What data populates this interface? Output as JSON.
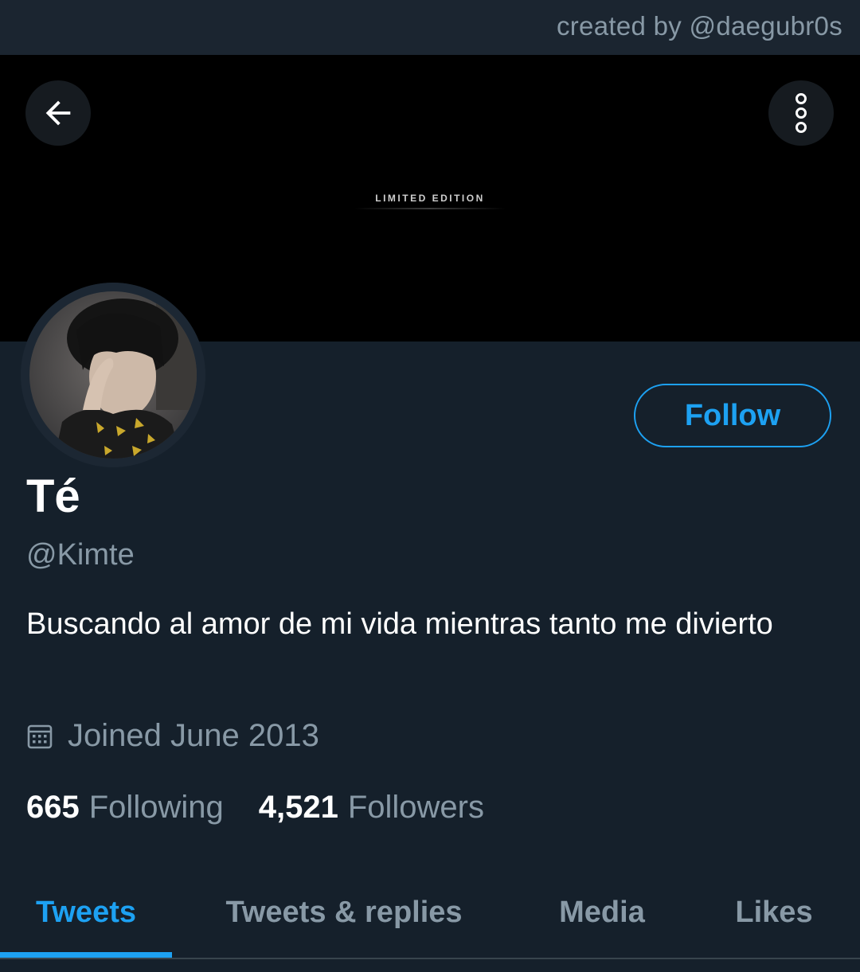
{
  "watermark": "created by @daegubr0s",
  "banner": {
    "text": "LIMITED EDITION"
  },
  "header": {
    "back_icon": "arrow-left-icon",
    "more_icon": "more-vertical-icon"
  },
  "profile": {
    "display_name": "Té",
    "handle": "@Kimte",
    "bio": "Buscando al amor de mi vida mientras tanto me divierto",
    "joined": "Joined June 2013",
    "joined_icon": "calendar-icon",
    "follow_label": "Follow",
    "following_count": "665",
    "following_label": "Following",
    "followers_count": "4,521",
    "followers_label": "Followers"
  },
  "tabs": [
    {
      "label": "Tweets",
      "active": true
    },
    {
      "label": "Tweets & replies",
      "active": false
    },
    {
      "label": "Media",
      "active": false
    },
    {
      "label": "Likes",
      "active": false
    }
  ],
  "colors": {
    "background": "#15202b",
    "accent": "#1da1f2",
    "secondary_text": "#8899a6"
  }
}
